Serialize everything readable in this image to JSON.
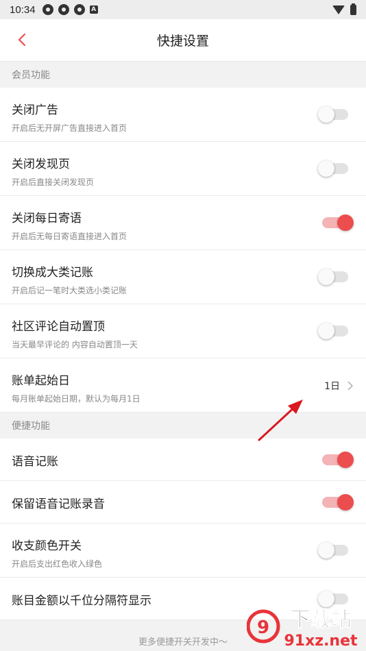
{
  "status": {
    "time": "10:34",
    "a_glyph": "A"
  },
  "header": {
    "title": "快捷设置"
  },
  "sections": [
    {
      "title": "会员功能"
    },
    {
      "title": "便捷功能"
    }
  ],
  "member_items": [
    {
      "label": "关闭广告",
      "sub": "开启后无开屏广告直接进入首页",
      "on": false
    },
    {
      "label": "关闭发现页",
      "sub": "开启后直接关闭发现页",
      "on": false
    },
    {
      "label": "关闭每日寄语",
      "sub": "开启后无每日寄语直接进入首页",
      "on": true
    },
    {
      "label": "切换成大类记账",
      "sub": " 开启后记一笔时大类选小类记账",
      "on": false
    },
    {
      "label": "社区评论自动置顶",
      "sub": "当天最早评论的 内容自动置顶一天",
      "on": false
    },
    {
      "label": "账单起始日",
      "sub": "每月账单起始日期，默认为每月1日",
      "value": "1日"
    }
  ],
  "convenience_items": [
    {
      "label": "语音记账",
      "on": true
    },
    {
      "label": "保留语音记账录音",
      "on": true
    },
    {
      "label": "收支颜色开关",
      "sub": "开启后支出红色收入绿色",
      "on": false
    },
    {
      "label": "账目金额以千位分隔符显示",
      "on": false
    }
  ],
  "footer": {
    "text": "更多便捷开关开发中～"
  },
  "colors": {
    "accent": "#ec4d4f",
    "accent_track": "#f4b3b5",
    "off_track": "#e2e2e2"
  },
  "watermark": {
    "text_top": "下载站",
    "text_bottom": "91xz.net"
  }
}
